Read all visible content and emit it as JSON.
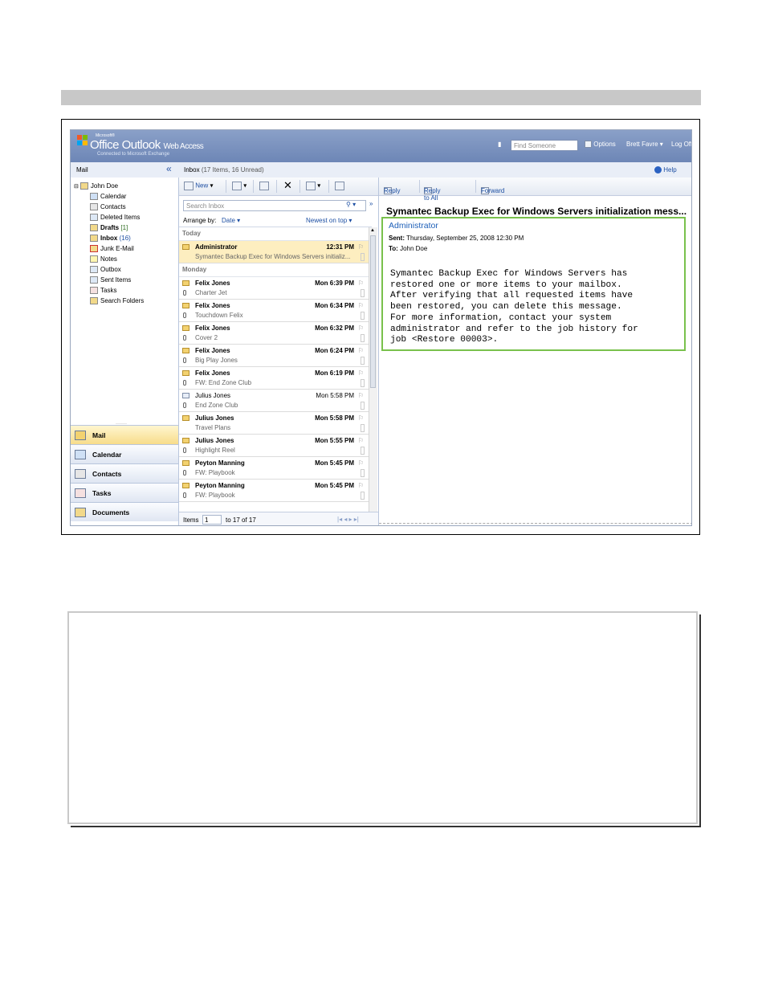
{
  "header": {
    "microsoft": "Microsoft®",
    "product": "Office Outlook",
    "web_access": "Web Access",
    "connected": "Connected to Microsoft Exchange",
    "find_placeholder": "Find Someone",
    "options": "Options",
    "user": "Brett Favre",
    "logoff": "Log Off"
  },
  "subbar": {
    "mail": "Mail",
    "collapse": "«",
    "inbox": "Inbox",
    "inbox_count": "(17 Items, 16 Unread)",
    "help": "Help"
  },
  "folders": [
    {
      "label": "John Doe",
      "bold": true,
      "count": ""
    },
    {
      "label": "Calendar",
      "bold": false,
      "count": ""
    },
    {
      "label": "Contacts",
      "bold": false,
      "count": ""
    },
    {
      "label": "Deleted Items",
      "bold": false,
      "count": ""
    },
    {
      "label": "Drafts",
      "bold": true,
      "count": "[1]"
    },
    {
      "label": "Inbox",
      "bold": true,
      "count": "(16)"
    },
    {
      "label": "Junk E-Mail",
      "bold": false,
      "count": ""
    },
    {
      "label": "Notes",
      "bold": false,
      "count": ""
    },
    {
      "label": "Outbox",
      "bold": false,
      "count": ""
    },
    {
      "label": "Sent Items",
      "bold": false,
      "count": ""
    },
    {
      "label": "Tasks",
      "bold": false,
      "count": ""
    },
    {
      "label": "Search Folders",
      "bold": false,
      "count": ""
    }
  ],
  "nav": [
    "Mail",
    "Calendar",
    "Contacts",
    "Tasks",
    "Documents"
  ],
  "toolbar": {
    "new": "New"
  },
  "search_placeholder": "Search Inbox",
  "arrange": {
    "label": "Arrange by:",
    "value": "Date",
    "order": "Newest on top"
  },
  "groups": {
    "today": "Today",
    "monday": "Monday"
  },
  "messages": [
    {
      "from": "Administrator",
      "time": "12:31 PM",
      "subject": "Symantec Backup Exec for Windows Servers initializ...",
      "unread": true
    },
    {
      "from": "Felix Jones",
      "time": "Mon 6:39 PM",
      "subject": "Charter Jet",
      "unread": true
    },
    {
      "from": "Felix Jones",
      "time": "Mon 6:34 PM",
      "subject": "Touchdown Felix",
      "unread": true
    },
    {
      "from": "Felix Jones",
      "time": "Mon 6:32 PM",
      "subject": "Cover 2",
      "unread": true
    },
    {
      "from": "Felix Jones",
      "time": "Mon 6:24 PM",
      "subject": "Big Play Jones",
      "unread": true
    },
    {
      "from": "Felix Jones",
      "time": "Mon 6:19 PM",
      "subject": "FW: End Zone Club",
      "unread": true
    },
    {
      "from": "Julius Jones",
      "time": "Mon 5:58 PM",
      "subject": "End Zone Club",
      "unread": false
    },
    {
      "from": "Julius Jones",
      "time": "Mon 5:58 PM",
      "subject": "Travel Plans",
      "unread": true
    },
    {
      "from": "Julius Jones",
      "time": "Mon 5:55 PM",
      "subject": "Highlight Reel",
      "unread": true
    },
    {
      "from": "Peyton Manning",
      "time": "Mon 5:45 PM",
      "subject": "FW: Playbook",
      "unread": true
    },
    {
      "from": "Peyton Manning",
      "time": "Mon 5:45 PM",
      "subject": "FW: Playbook",
      "unread": true
    }
  ],
  "footer": {
    "items": "Items",
    "page_value": "1",
    "range": "to 17 of 17"
  },
  "reading": {
    "reply": "Reply",
    "reply_all": "Reply to All",
    "forward": "Forward",
    "subject": "Symantec Backup Exec for Windows Servers initialization mess...",
    "sender": "Administrator",
    "sent_label": "Sent:",
    "sent_value": "Thursday, September 25, 2008 12:30 PM",
    "to_label": "To:",
    "to_value": "John Doe",
    "body": "Symantec Backup Exec for Windows Servers has\nrestored one or more items to your mailbox.\nAfter verifying that all requested items have\nbeen restored, you can delete this message.\nFor more information, contact your system\nadministrator and refer to the job history for\njob <Restore 00003>."
  },
  "colors": {
    "header_blue": "#6d86b6",
    "selected_row": "#fdeec0",
    "highlight_box": "#79c14c",
    "link_blue": "#1d4fa3"
  }
}
